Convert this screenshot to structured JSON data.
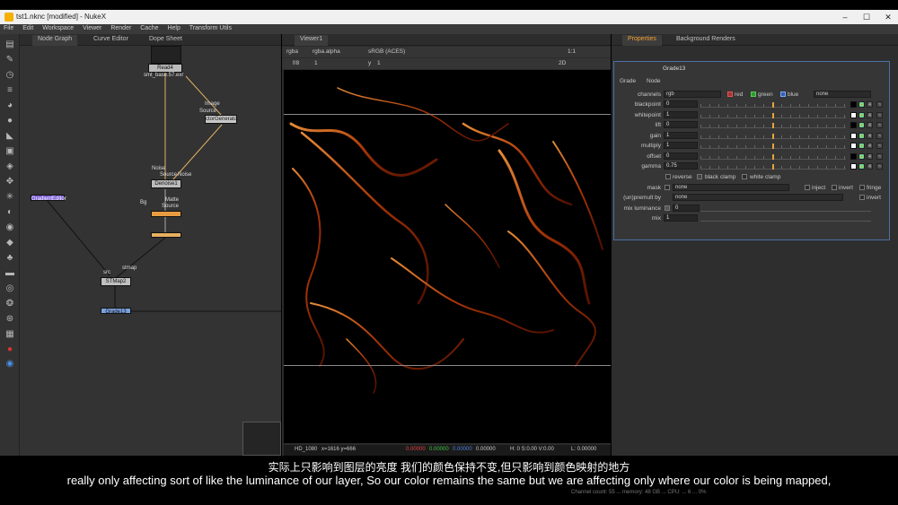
{
  "window": {
    "title": "tst1.nknc [modified] - NukeX",
    "controls": [
      "–",
      "☐",
      "✕"
    ]
  },
  "menu": [
    "File",
    "Edit",
    "Workspace",
    "Viewer",
    "Render",
    "Cache",
    "Help",
    "Transform Utils"
  ],
  "left_tabs": [
    "Node Graph",
    "Curve Editor",
    "Dope Sheet"
  ],
  "nodes": {
    "read": "Read4",
    "read_file": "smt_base.57.exr",
    "generator": "ctorGenerato",
    "generator_in1": "Image",
    "generator_in2": "Source",
    "denoise": "Denoise1",
    "denoise_in1": "Noise",
    "denoise_in2": "Source",
    "denoise_in3": "Noise",
    "blend_in1": "Bg",
    "blend_in2": "Matte",
    "blend_in3": "Source",
    "gradient": "GradientEditor",
    "stmap": "STMap2",
    "stmap_in1": "src",
    "stmap_in2": "stmap",
    "grade": "Grade13"
  },
  "viewer": {
    "tab": "Viewer1",
    "channels": "rgba",
    "alpha": "rgba.alpha",
    "colorspace": "sRGB (ACES)",
    "frame": "f/8",
    "frame_value": "1",
    "y_label": "y",
    "y_value": "1",
    "ratio": "1:1",
    "mode": "2D",
    "status_format": "HD_1080",
    "status_coords": "x=1616 y=666",
    "status_r": "0.00000",
    "status_g": "0.00000",
    "status_b": "0.00000",
    "status_a": "0.00000",
    "status_h": "H: 0 S:0.00 V:0.00",
    "status_l": "L: 0.00000"
  },
  "properties": {
    "tabs": [
      "Properties",
      "Background Renders"
    ],
    "node_name": "Grade13",
    "subtabs": [
      "Grade",
      "Node"
    ],
    "channels_label": "channels",
    "channels_value": "rgb",
    "red_label": "red",
    "green_label": "green",
    "blue_label": "blue",
    "channels_extra": "none",
    "knobs": [
      {
        "label": "blackpoint",
        "value": "0"
      },
      {
        "label": "whitepoint",
        "value": "1"
      },
      {
        "label": "lift",
        "value": "0"
      },
      {
        "label": "gain",
        "value": "1"
      },
      {
        "label": "multiply",
        "value": "1"
      },
      {
        "label": "offset",
        "value": "0"
      },
      {
        "label": "gamma",
        "value": "0.75"
      }
    ],
    "reverse_label": "reverse",
    "black_clamp_label": "black clamp",
    "white_clamp_label": "white clamp",
    "mask_label": "mask",
    "mask_value": "none",
    "inject_label": "inject",
    "invert_label": "invert",
    "fringe_label": "fringe",
    "premult_label": "(un)premult by",
    "premult_value": "none",
    "invert2_label": "invert",
    "mixlum_label": "mix luminance",
    "mixlum_value": "0",
    "mix_label": "mix",
    "mix_value": "1"
  },
  "subtitles": {
    "zh": "实际上只影响到图层的亮度 我们的颜色保持不变,但只影响到颜色映射的地方",
    "en": "really only affecting sort of like the luminance of our layer, So our color remains the same but we are affecting only where our color is being mapped,"
  },
  "bottom_ghost": "Channel count: 55 ... memory: 48 GB ... CPU: ... 6 ... 0%"
}
